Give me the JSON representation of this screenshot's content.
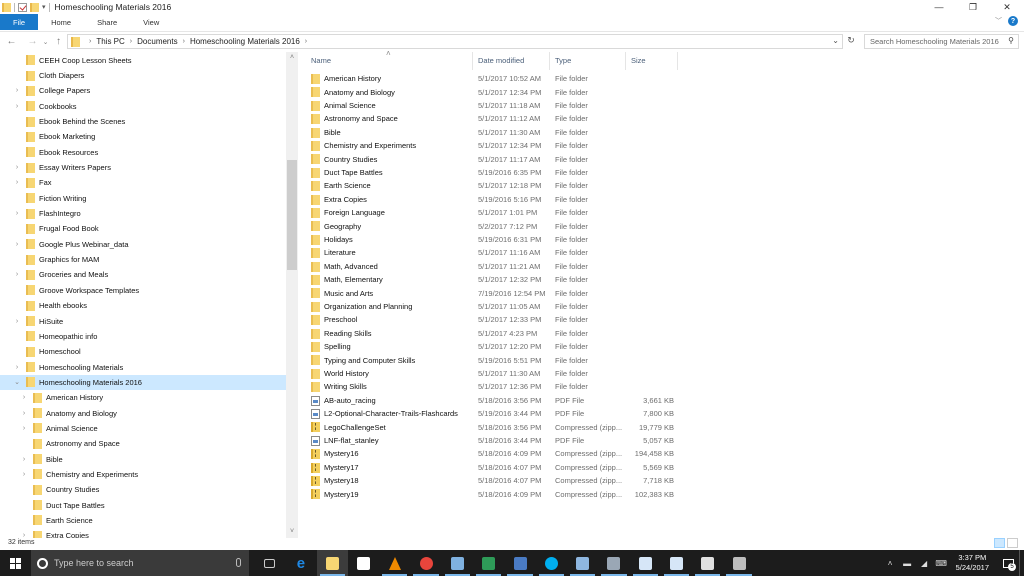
{
  "window": {
    "title": "Homeschooling Materials 2016",
    "controls": {
      "minimize": "—",
      "restore": "❐",
      "close": "✕"
    }
  },
  "ribbon": {
    "tabs": [
      {
        "label": "File",
        "active": true
      },
      {
        "label": "Home"
      },
      {
        "label": "Share"
      },
      {
        "label": "View"
      }
    ],
    "help_label": "?"
  },
  "address": {
    "breadcrumbs": [
      "This PC",
      "Documents",
      "Homeschooling Materials 2016"
    ],
    "search_placeholder": "Search Homeschooling Materials 2016"
  },
  "nav_pane": {
    "items": [
      {
        "label": "CEEH Coop Lesson Sheets",
        "level": 1,
        "expandable": false
      },
      {
        "label": "Cloth Diapers",
        "level": 1,
        "expandable": false
      },
      {
        "label": "College Papers",
        "level": 1,
        "expandable": true
      },
      {
        "label": "Cookbooks",
        "level": 1,
        "expandable": true
      },
      {
        "label": "Ebook Behind the Scenes",
        "level": 1,
        "expandable": false
      },
      {
        "label": "Ebook Marketing",
        "level": 1,
        "expandable": false
      },
      {
        "label": "Ebook Resources",
        "level": 1,
        "expandable": false
      },
      {
        "label": "Essay Writers Papers",
        "level": 1,
        "expandable": true
      },
      {
        "label": "Fax",
        "level": 1,
        "expandable": true
      },
      {
        "label": "Fiction Writing",
        "level": 1,
        "expandable": false
      },
      {
        "label": "FlashIntegro",
        "level": 1,
        "expandable": true
      },
      {
        "label": "Frugal Food Book",
        "level": 1,
        "expandable": false
      },
      {
        "label": "Google Plus Webinar_data",
        "level": 1,
        "expandable": true
      },
      {
        "label": "Graphics for MAM",
        "level": 1,
        "expandable": false
      },
      {
        "label": "Groceries and Meals",
        "level": 1,
        "expandable": true
      },
      {
        "label": "Groove Workspace Templates",
        "level": 1,
        "expandable": false
      },
      {
        "label": "Health ebooks",
        "level": 1,
        "expandable": false
      },
      {
        "label": "HiSuite",
        "level": 1,
        "expandable": true
      },
      {
        "label": "Homeopathic info",
        "level": 1,
        "expandable": false
      },
      {
        "label": "Homeschool",
        "level": 1,
        "expandable": false
      },
      {
        "label": "Homeschooling Materials",
        "level": 1,
        "expandable": true
      },
      {
        "label": "Homeschooling Materials 2016",
        "level": 1,
        "expandable": true,
        "expanded": true,
        "selected": true
      },
      {
        "label": "American History",
        "level": 2,
        "expandable": true
      },
      {
        "label": "Anatomy and Biology",
        "level": 2,
        "expandable": true
      },
      {
        "label": "Animal Science",
        "level": 2,
        "expandable": true
      },
      {
        "label": "Astronomy and Space",
        "level": 2,
        "expandable": false
      },
      {
        "label": "Bible",
        "level": 2,
        "expandable": true
      },
      {
        "label": "Chemistry and Experiments",
        "level": 2,
        "expandable": true
      },
      {
        "label": "Country Studies",
        "level": 2,
        "expandable": false
      },
      {
        "label": "Duct Tape Battles",
        "level": 2,
        "expandable": false
      },
      {
        "label": "Earth Science",
        "level": 2,
        "expandable": false
      },
      {
        "label": "Extra Copies",
        "level": 2,
        "expandable": true
      }
    ]
  },
  "columns": {
    "name": "Name",
    "date": "Date modified",
    "type": "Type",
    "size": "Size"
  },
  "files": [
    {
      "name": "American History",
      "date": "5/1/2017 10:52 AM",
      "type": "File folder",
      "size": "",
      "kind": "folder"
    },
    {
      "name": "Anatomy and Biology",
      "date": "5/1/2017 12:34 PM",
      "type": "File folder",
      "size": "",
      "kind": "folder"
    },
    {
      "name": "Animal Science",
      "date": "5/1/2017 11:18 AM",
      "type": "File folder",
      "size": "",
      "kind": "folder"
    },
    {
      "name": "Astronomy and Space",
      "date": "5/1/2017 11:12 AM",
      "type": "File folder",
      "size": "",
      "kind": "folder"
    },
    {
      "name": "Bible",
      "date": "5/1/2017 11:30 AM",
      "type": "File folder",
      "size": "",
      "kind": "folder"
    },
    {
      "name": "Chemistry and Experiments",
      "date": "5/1/2017 12:34 PM",
      "type": "File folder",
      "size": "",
      "kind": "folder"
    },
    {
      "name": "Country Studies",
      "date": "5/1/2017 11:17 AM",
      "type": "File folder",
      "size": "",
      "kind": "folder"
    },
    {
      "name": "Duct Tape Battles",
      "date": "5/19/2016 6:35 PM",
      "type": "File folder",
      "size": "",
      "kind": "folder"
    },
    {
      "name": "Earth Science",
      "date": "5/1/2017 12:18 PM",
      "type": "File folder",
      "size": "",
      "kind": "folder"
    },
    {
      "name": "Extra Copies",
      "date": "5/19/2016 5:16 PM",
      "type": "File folder",
      "size": "",
      "kind": "folder"
    },
    {
      "name": "Foreign Language",
      "date": "5/1/2017 1:01 PM",
      "type": "File folder",
      "size": "",
      "kind": "folder"
    },
    {
      "name": "Geography",
      "date": "5/2/2017 7:12 PM",
      "type": "File folder",
      "size": "",
      "kind": "folder"
    },
    {
      "name": "Holidays",
      "date": "5/19/2016 6:31 PM",
      "type": "File folder",
      "size": "",
      "kind": "folder"
    },
    {
      "name": "Literature",
      "date": "5/1/2017 11:16 AM",
      "type": "File folder",
      "size": "",
      "kind": "folder"
    },
    {
      "name": "Math, Advanced",
      "date": "5/1/2017 11:21 AM",
      "type": "File folder",
      "size": "",
      "kind": "folder"
    },
    {
      "name": "Math, Elementary",
      "date": "5/1/2017 12:32 PM",
      "type": "File folder",
      "size": "",
      "kind": "folder"
    },
    {
      "name": "Music and Arts",
      "date": "7/19/2016 12:54 PM",
      "type": "File folder",
      "size": "",
      "kind": "folder"
    },
    {
      "name": "Organization and Planning",
      "date": "5/1/2017 11:05 AM",
      "type": "File folder",
      "size": "",
      "kind": "folder"
    },
    {
      "name": "Preschool",
      "date": "5/1/2017 12:33 PM",
      "type": "File folder",
      "size": "",
      "kind": "folder"
    },
    {
      "name": "Reading Skills",
      "date": "5/1/2017 4:23 PM",
      "type": "File folder",
      "size": "",
      "kind": "folder"
    },
    {
      "name": "Spelling",
      "date": "5/1/2017 12:20 PM",
      "type": "File folder",
      "size": "",
      "kind": "folder"
    },
    {
      "name": "Typing and Computer Skills",
      "date": "5/19/2016 5:51 PM",
      "type": "File folder",
      "size": "",
      "kind": "folder"
    },
    {
      "name": "World History",
      "date": "5/1/2017 11:30 AM",
      "type": "File folder",
      "size": "",
      "kind": "folder"
    },
    {
      "name": "Writing Skills",
      "date": "5/1/2017 12:36 PM",
      "type": "File folder",
      "size": "",
      "kind": "folder"
    },
    {
      "name": "AB-auto_racing",
      "date": "5/18/2016 3:56 PM",
      "type": "PDF File",
      "size": "3,661 KB",
      "kind": "pdf"
    },
    {
      "name": "L2-Optional-Character-Trails-Flashcards",
      "date": "5/19/2016 3:44 PM",
      "type": "PDF File",
      "size": "7,800 KB",
      "kind": "pdf"
    },
    {
      "name": "LegoChallengeSet",
      "date": "5/18/2016 3:56 PM",
      "type": "Compressed (zipp...",
      "size": "19,779 KB",
      "kind": "zip"
    },
    {
      "name": "LNF-flat_stanley",
      "date": "5/18/2016 3:44 PM",
      "type": "PDF File",
      "size": "5,057 KB",
      "kind": "pdf"
    },
    {
      "name": "Mystery16",
      "date": "5/18/2016 4:09 PM",
      "type": "Compressed (zipp...",
      "size": "194,458 KB",
      "kind": "zip"
    },
    {
      "name": "Mystery17",
      "date": "5/18/2016 4:07 PM",
      "type": "Compressed (zipp...",
      "size": "5,569 KB",
      "kind": "zip"
    },
    {
      "name": "Mystery18",
      "date": "5/18/2016 4:07 PM",
      "type": "Compressed (zipp...",
      "size": "7,718 KB",
      "kind": "zip"
    },
    {
      "name": "Mystery19",
      "date": "5/18/2016 4:09 PM",
      "type": "Compressed (zipp...",
      "size": "102,383 KB",
      "kind": "zip"
    }
  ],
  "status": {
    "item_count": "32 items"
  },
  "taskbar": {
    "search_placeholder": "Type here to search",
    "apps": [
      {
        "name": "task-view",
        "color": "#cccccc",
        "running": false
      },
      {
        "name": "edge",
        "color": "#1e88e5",
        "running": false
      },
      {
        "name": "file-explorer",
        "color": "#f7d673",
        "running": true,
        "active": true
      },
      {
        "name": "store",
        "color": "#ffffff",
        "running": false
      },
      {
        "name": "vlc",
        "color": "#f08a00",
        "running": true
      },
      {
        "name": "chrome",
        "color": "#e8453c",
        "running": true
      },
      {
        "name": "notepad-app",
        "color": "#7fb1e0",
        "running": true
      },
      {
        "name": "excel",
        "color": "#2e9b58",
        "running": true
      },
      {
        "name": "word-publisher",
        "color": "#4a7bc4",
        "running": true
      },
      {
        "name": "skype",
        "color": "#00aff0",
        "running": true
      },
      {
        "name": "document-app",
        "color": "#8fb7e0",
        "running": true
      },
      {
        "name": "remote-desktop",
        "color": "#9aa7b5",
        "running": true
      },
      {
        "name": "file-a",
        "color": "#d6e6f7",
        "running": true
      },
      {
        "name": "file-b",
        "color": "#d6e6f7",
        "running": true
      },
      {
        "name": "calculator",
        "color": "#e0e0e0",
        "running": true
      },
      {
        "name": "printer",
        "color": "#bdbdbd",
        "running": true
      }
    ],
    "clock_time": "3:37 PM",
    "clock_date": "5/24/2017",
    "notification_count": "5"
  }
}
